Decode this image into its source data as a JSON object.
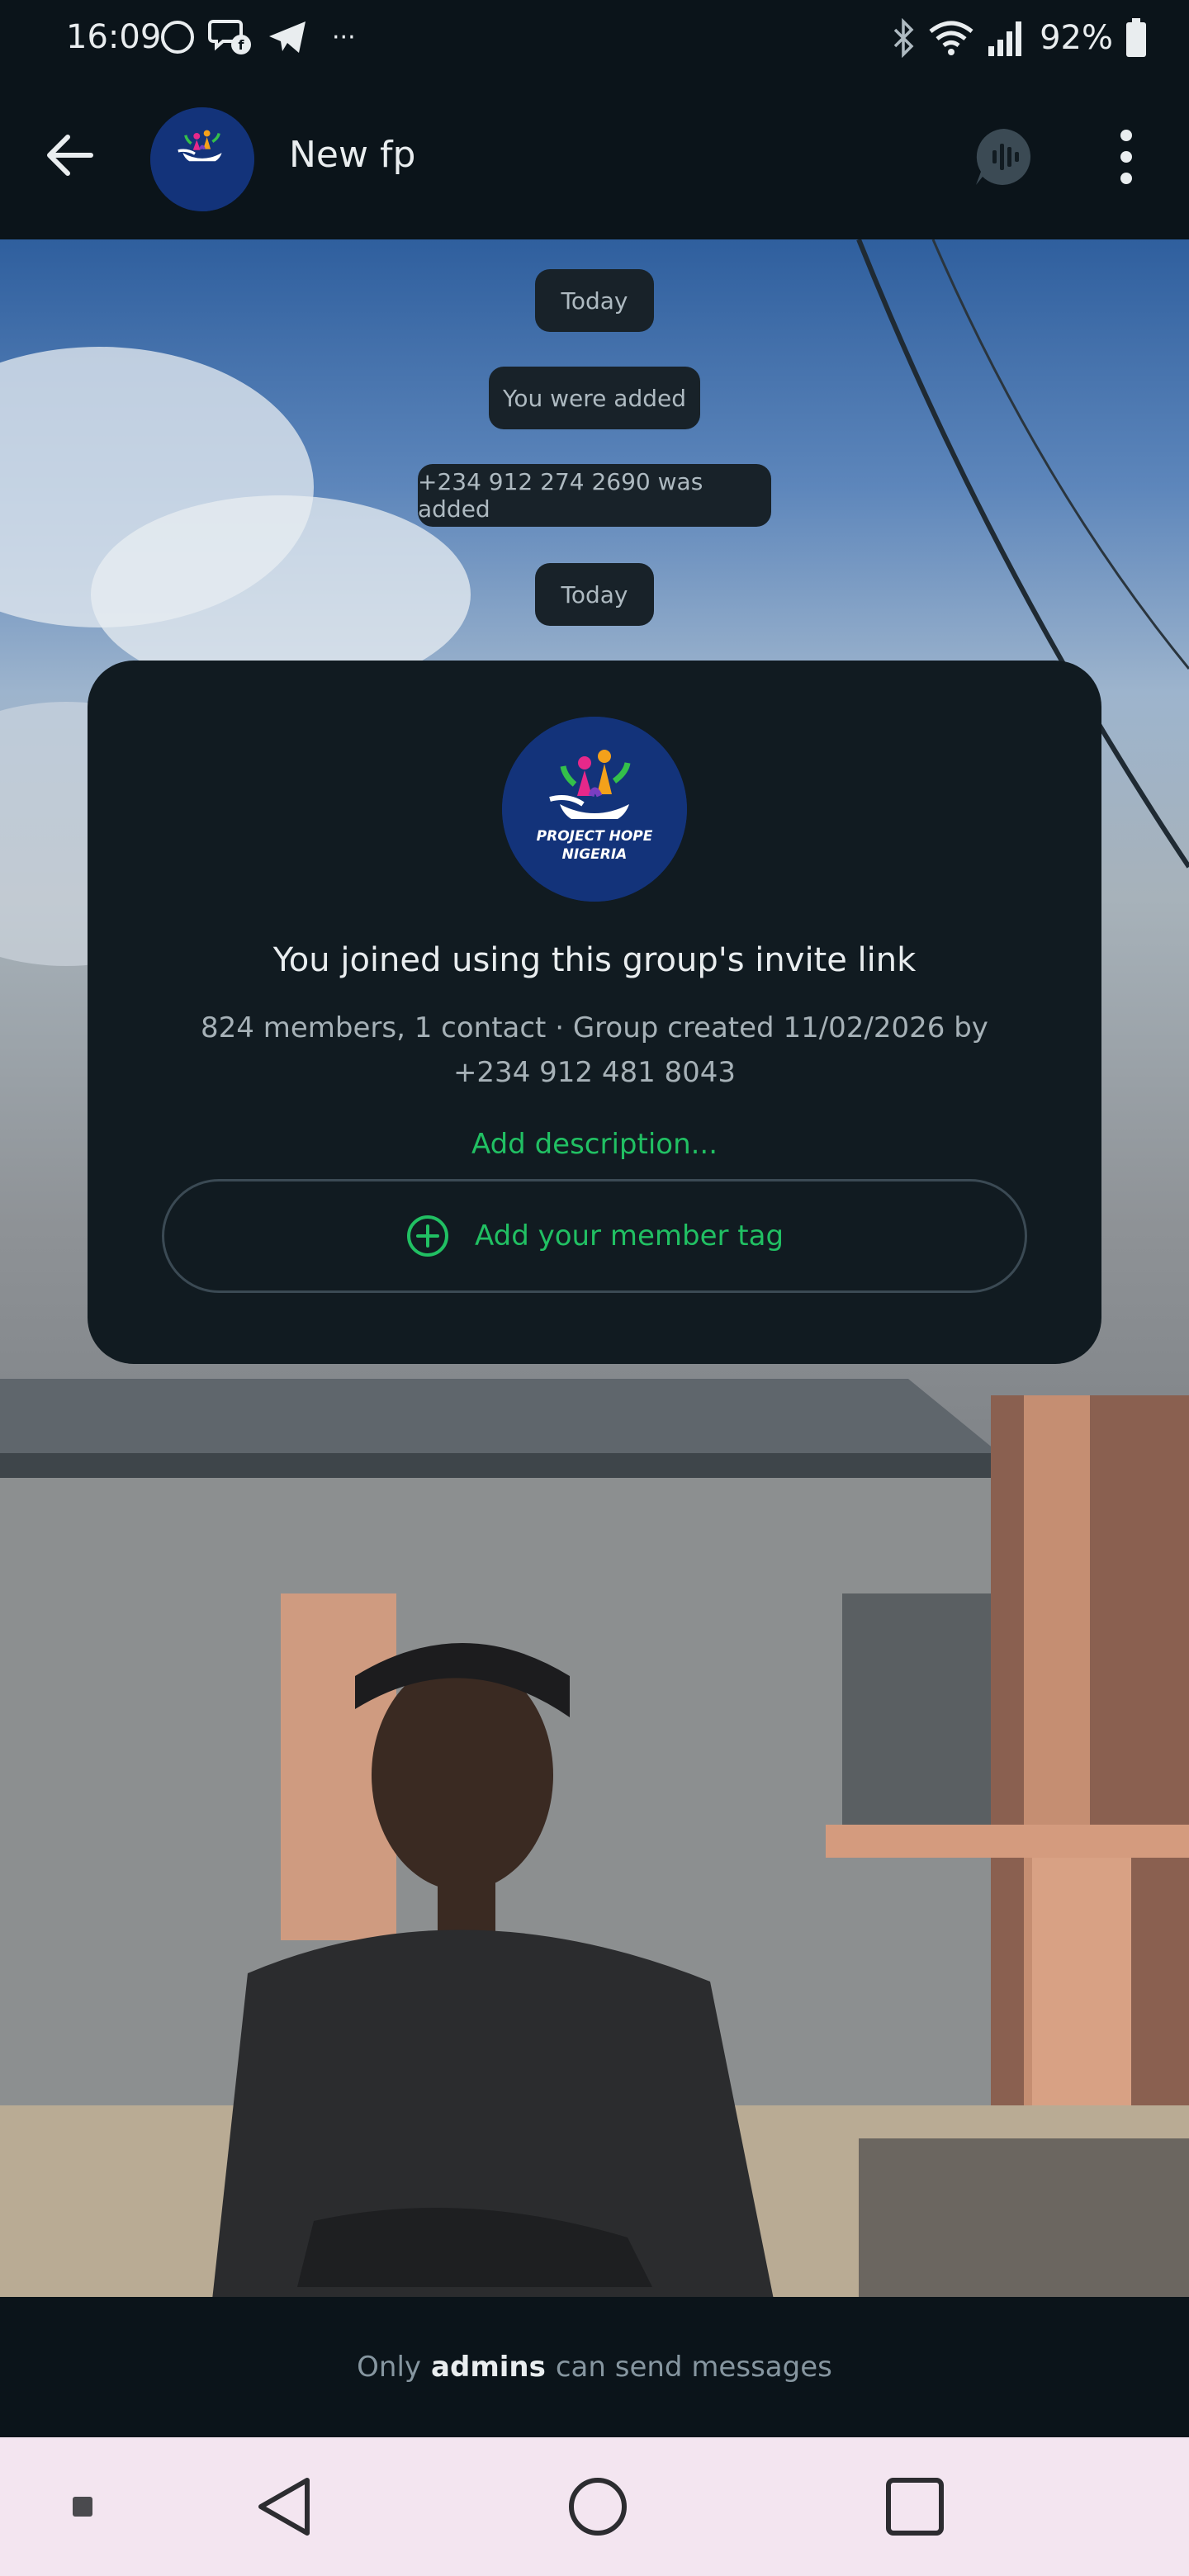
{
  "status_bar": {
    "time": "16:09",
    "more_indicator": "···",
    "battery": "92%"
  },
  "header": {
    "chat_name": "New fp",
    "avatar_text": [
      "PROJECT HOPE",
      "NIGERIA"
    ]
  },
  "messages": {
    "date_chip_1": "Today",
    "system_1": "You were added",
    "system_2": "+234 912 274 2690 was added",
    "date_chip_2": "Today"
  },
  "group_card": {
    "title": "You joined using this group's invite link",
    "meta_line_1": "824 members, 1 contact · Group created 11/02/2026 by",
    "meta_line_2": "+234 912 481 8043",
    "add_description": "Add description...",
    "member_tag_button": "Add your member tag"
  },
  "footer": {
    "prefix": "Only",
    "bold": "admins",
    "suffix": "can send messages"
  },
  "colors": {
    "accent_green": "#21c063",
    "background": "#0b141a",
    "card": "#111b21",
    "chip": "#182229",
    "nav_bar": "#f3e5f0"
  }
}
